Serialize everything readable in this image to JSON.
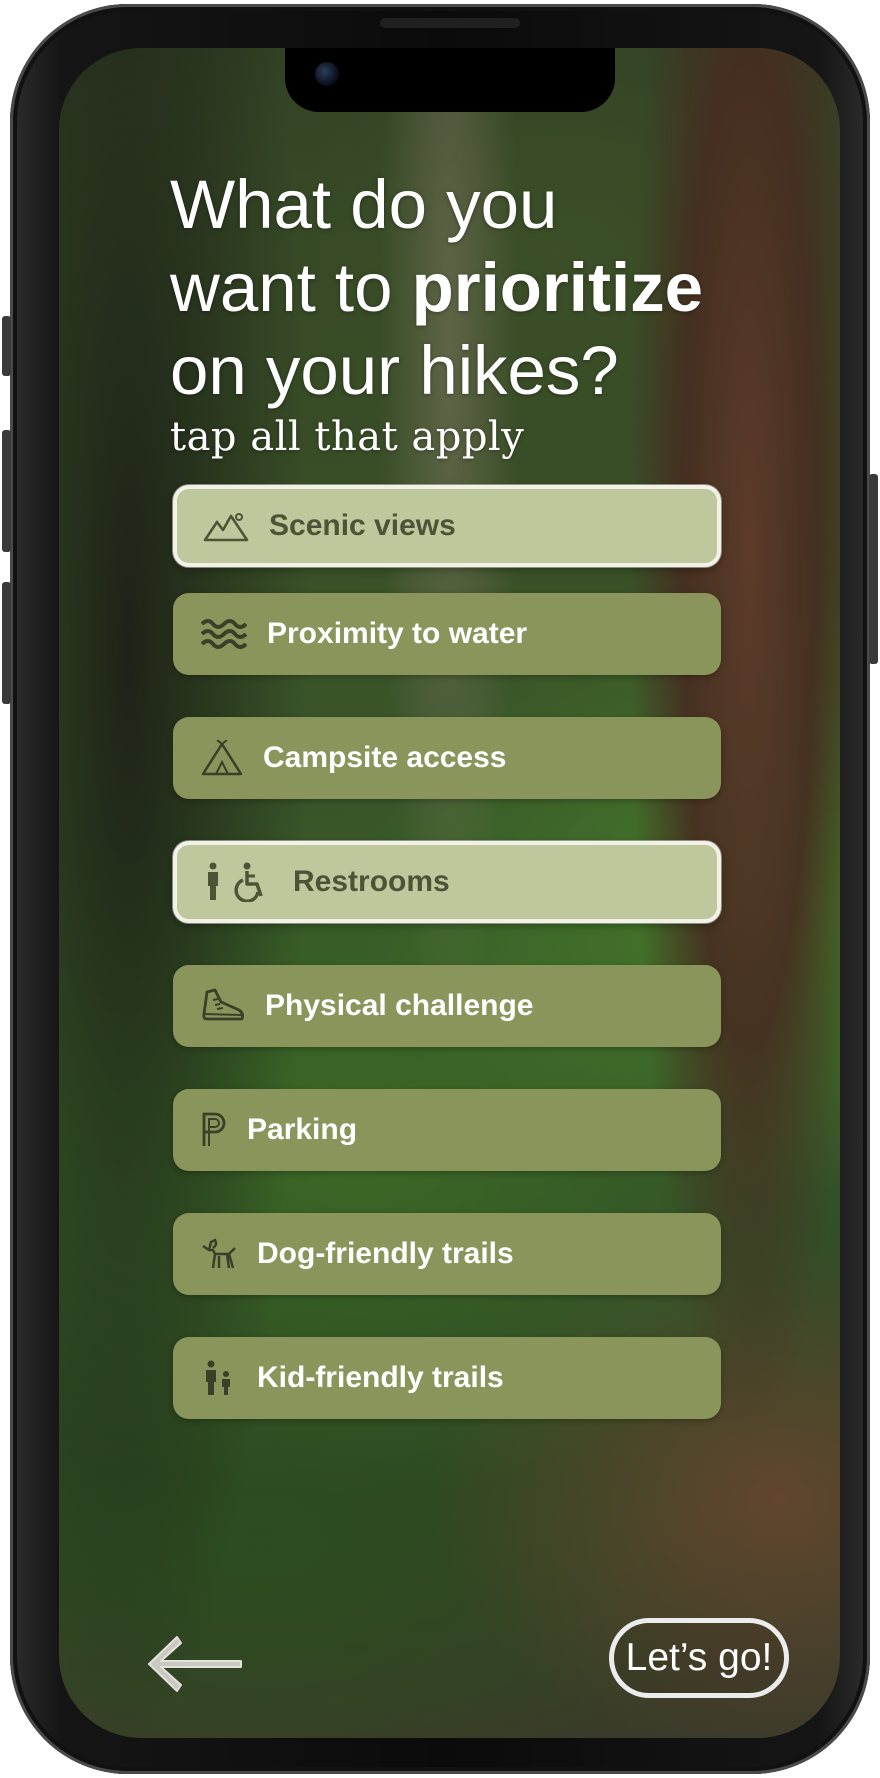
{
  "question": {
    "line1": "What do you",
    "line2_pre": "want to ",
    "line2_bold": "prioritize",
    "line3": "on your hikes?",
    "subtitle": "tap all that apply"
  },
  "options": [
    {
      "label": "Scenic views",
      "icon": "mountain-icon",
      "selected": true
    },
    {
      "label": "Proximity to water",
      "icon": "water-waves-icon",
      "selected": false
    },
    {
      "label": "Campsite access",
      "icon": "tent-icon",
      "selected": false
    },
    {
      "label": "Restrooms",
      "icon": "restroom-icon",
      "selected": true
    },
    {
      "label": "Physical challenge",
      "icon": "shoe-icon",
      "selected": false
    },
    {
      "label": "Parking",
      "icon": "parking-icon",
      "selected": false
    },
    {
      "label": "Dog-friendly trails",
      "icon": "dog-icon",
      "selected": false
    },
    {
      "label": "Kid-friendly trails",
      "icon": "family-icon",
      "selected": false
    }
  ],
  "navigation": {
    "back_icon": "back-arrow-icon",
    "next_label": "Let’s go!"
  },
  "colors": {
    "option_default": "#8a955c",
    "option_selected": "#bfc79c",
    "selected_text": "#4e5337"
  }
}
